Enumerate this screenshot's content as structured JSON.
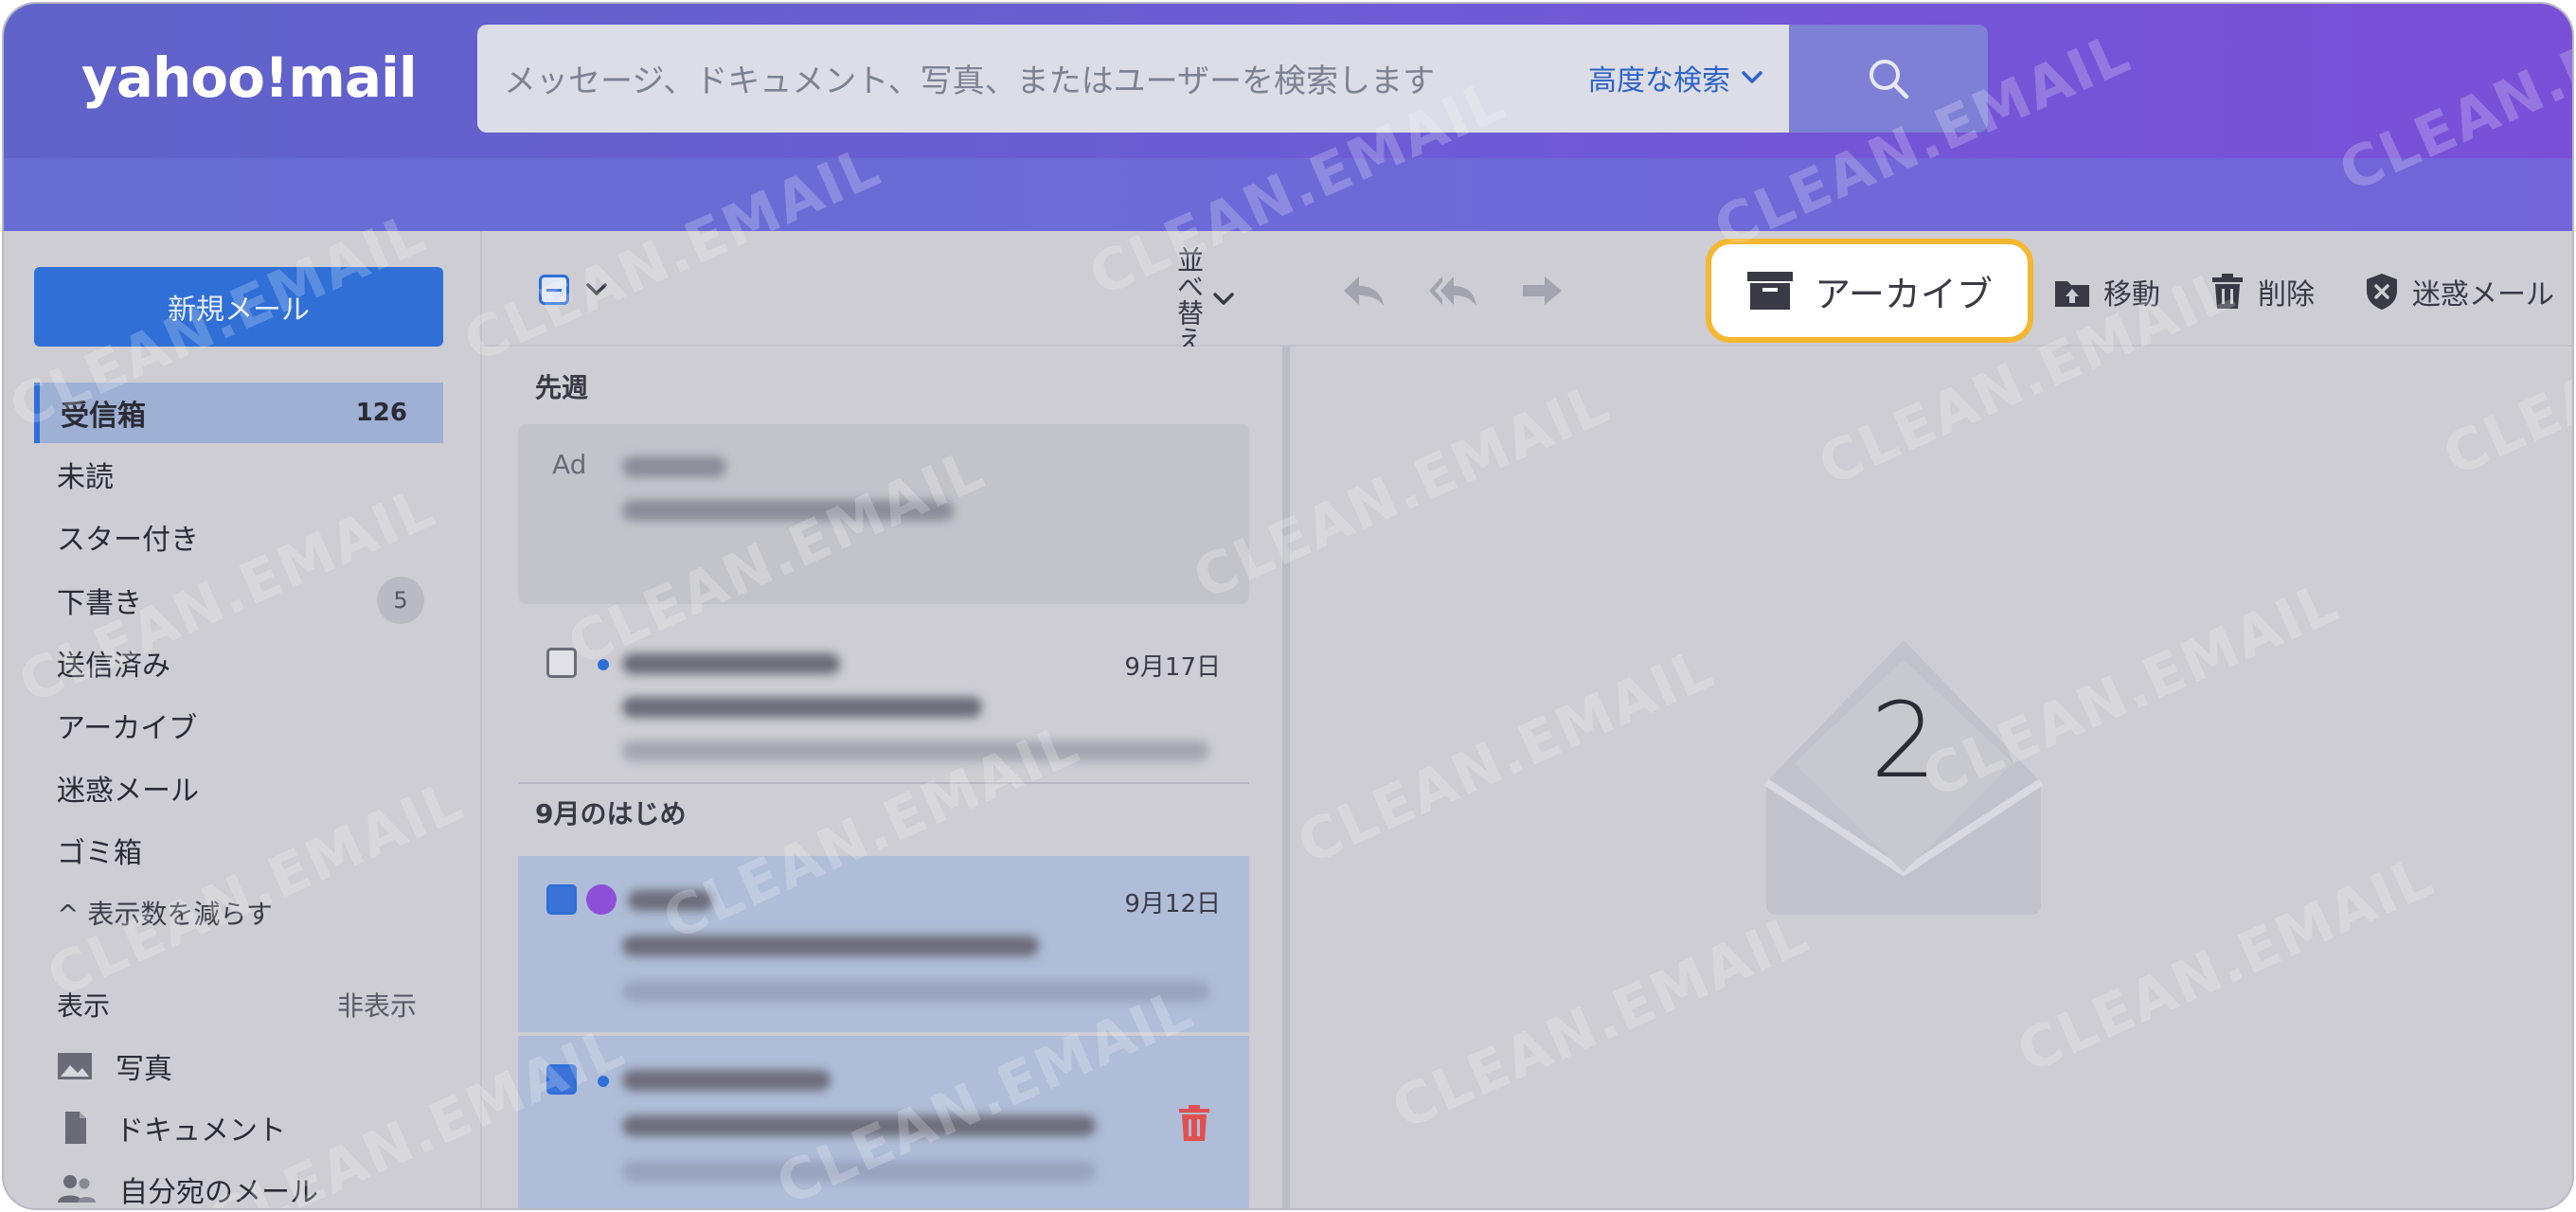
{
  "header": {
    "logo": "yahoo!mail",
    "search_placeholder": "メッセージ、ドキュメント、写真、またはユーザーを検索します",
    "advanced_search": "高度な検索",
    "search_icon": "search-icon"
  },
  "sidebar": {
    "compose": "新規メール",
    "folders": [
      {
        "label": "受信箱",
        "count": "126"
      },
      {
        "label": "未読"
      },
      {
        "label": "スター付き"
      },
      {
        "label": "下書き",
        "count": "5"
      },
      {
        "label": "送信済み"
      },
      {
        "label": "アーカイブ"
      },
      {
        "label": "迷惑メール"
      },
      {
        "label": "ゴミ箱"
      }
    ],
    "collapse": "^ 表示数を減らす",
    "view_label": "表示",
    "hide": "非表示",
    "views": [
      {
        "label": "写真",
        "icon": "photo-icon"
      },
      {
        "label": "ドキュメント",
        "icon": "document-icon"
      },
      {
        "label": "自分宛のメール",
        "icon": "people-icon"
      }
    ]
  },
  "toolbar": {
    "sort": "並べ替え",
    "archive": "アーカイブ",
    "move": "移動",
    "delete": "削除",
    "spam": "迷惑メール"
  },
  "message_list": {
    "groups": [
      "先週",
      "9月のはじめ"
    ],
    "ad_tag": "Ad",
    "dates": [
      "9月17日",
      "9月12日"
    ]
  },
  "reading_pane": {
    "selected_count": "2"
  },
  "watermark": "CLEAN.EMAIL",
  "colors": {
    "accent": "#2f6fd6",
    "highlight": "#f4b731",
    "header_start": "#5f63c9",
    "header_end": "#7a4fd8",
    "trash_red": "#e05050"
  }
}
